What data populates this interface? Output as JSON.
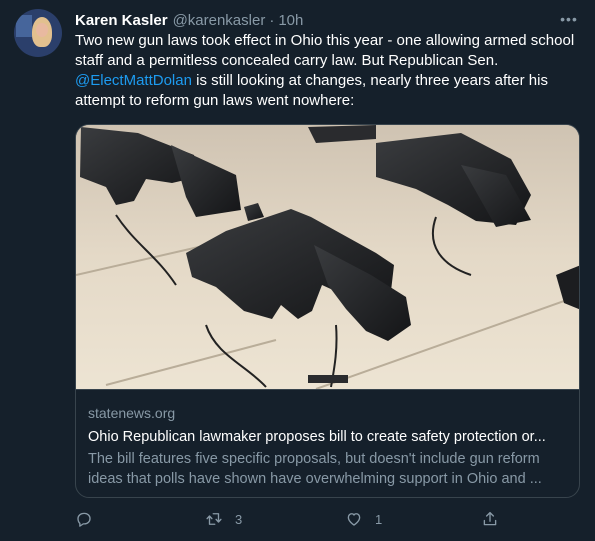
{
  "tweet": {
    "author_name": "Karen Kasler",
    "author_handle": "@karenkasler",
    "separator": "·",
    "time": "10h",
    "more_label": "•••",
    "text_part1": "Two new gun laws took effect in Ohio this year - one allowing armed school staff and a permitless concealed carry law. But Republican Sen. ",
    "mention": "@ElectMattDolan",
    "text_part2": " is still looking at changes, nearly three years after his attempt to reform gun laws went nowhere:"
  },
  "card": {
    "domain": "statenews.org",
    "title": "Ohio Republican lawmaker proposes bill to create safety protection or...",
    "description": "The bill features five specific proposals, but doesn't include gun reform ideas that polls have shown have overwhelming support in Ohio and ..."
  },
  "actions": {
    "reply_count": "",
    "retweet_count": "3",
    "like_count": "1"
  },
  "icons": [
    "reply-icon",
    "retweet-icon",
    "like-icon",
    "share-icon",
    "more-icon"
  ],
  "colors": {
    "background": "#15202b",
    "text": "#ffffff",
    "secondary": "#8899a6",
    "link": "#1d9bf0",
    "border": "#38444d"
  }
}
